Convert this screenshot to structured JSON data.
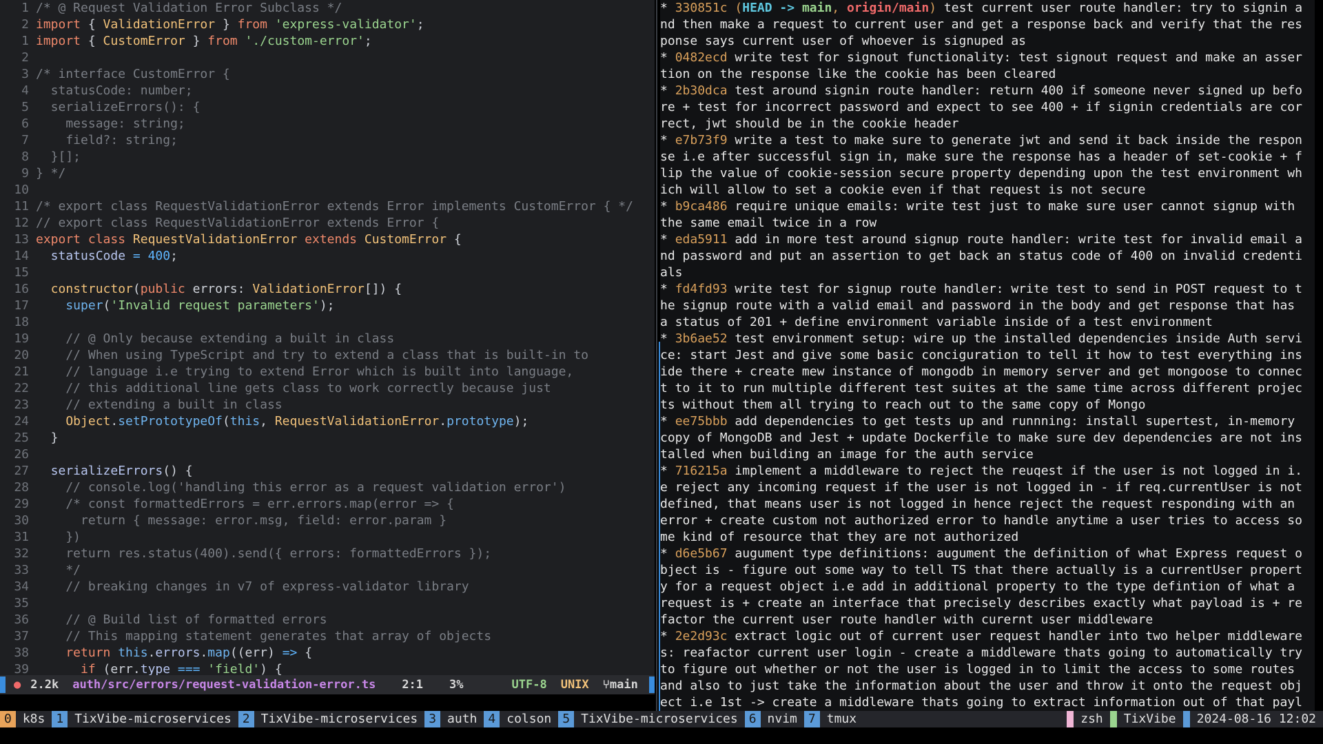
{
  "editor": {
    "lines": [
      {
        "n": "1",
        "t": [
          [
            "cm",
            "/* @ Request Validation Error Subclass */"
          ]
        ]
      },
      {
        "n": "2",
        "t": [
          [
            "kw",
            "import"
          ],
          [
            "var",
            " { "
          ],
          [
            "cls",
            "ValidationError"
          ],
          [
            "var",
            " } "
          ],
          [
            "kw",
            "from"
          ],
          [
            "var",
            " "
          ],
          [
            "str",
            "'express-validator'"
          ],
          [
            "var",
            ";"
          ]
        ]
      },
      {
        "n": "1",
        "t": [
          [
            "kw",
            "import"
          ],
          [
            "var",
            " { "
          ],
          [
            "cls",
            "CustomError"
          ],
          [
            "var",
            " } "
          ],
          [
            "kw",
            "from"
          ],
          [
            "var",
            " "
          ],
          [
            "str",
            "'./custom-error'"
          ],
          [
            "var",
            ";"
          ]
        ]
      },
      {
        "n": "2",
        "t": []
      },
      {
        "n": "3",
        "t": [
          [
            "cm",
            "/* interface CustomError {"
          ]
        ]
      },
      {
        "n": "4",
        "t": [
          [
            "cm",
            "  statusCode: number;"
          ]
        ]
      },
      {
        "n": "5",
        "t": [
          [
            "cm",
            "  serializeErrors(): {"
          ]
        ]
      },
      {
        "n": "6",
        "t": [
          [
            "cm",
            "    message: string;"
          ]
        ]
      },
      {
        "n": "7",
        "t": [
          [
            "cm",
            "    field?: string;"
          ]
        ]
      },
      {
        "n": "8",
        "t": [
          [
            "cm",
            "  }[];"
          ]
        ]
      },
      {
        "n": "9",
        "t": [
          [
            "cm",
            "} */"
          ]
        ]
      },
      {
        "n": "10",
        "t": []
      },
      {
        "n": "11",
        "t": [
          [
            "cm",
            "/* export class RequestValidationError extends Error implements CustomError { */"
          ]
        ]
      },
      {
        "n": "12",
        "t": [
          [
            "cm",
            "// export class RequestValidationError extends Error {"
          ]
        ]
      },
      {
        "n": "13",
        "t": [
          [
            "kw",
            "export class "
          ],
          [
            "cls",
            "RequestValidationError"
          ],
          [
            "kw",
            " extends "
          ],
          [
            "cls",
            "CustomError"
          ],
          [
            "var",
            " {"
          ]
        ]
      },
      {
        "n": "14",
        "t": [
          [
            "prop",
            "  statusCode"
          ],
          [
            "op",
            " = "
          ],
          [
            "num",
            "400"
          ],
          [
            "var",
            ";"
          ]
        ]
      },
      {
        "n": "15",
        "t": []
      },
      {
        "n": "16",
        "t": [
          [
            "cls",
            "  constructor"
          ],
          [
            "var",
            "("
          ],
          [
            "kw",
            "public"
          ],
          [
            "var",
            " errors: "
          ],
          [
            "cls",
            "ValidationError"
          ],
          [
            "var",
            "[]) {"
          ]
        ]
      },
      {
        "n": "17",
        "t": [
          [
            "fn",
            "    super"
          ],
          [
            "var",
            "("
          ],
          [
            "str",
            "'Invalid request parameters'"
          ],
          [
            "var",
            ");"
          ]
        ]
      },
      {
        "n": "18",
        "t": []
      },
      {
        "n": "19",
        "t": [
          [
            "cm",
            "    // @ Only because extending a built in class"
          ]
        ]
      },
      {
        "n": "20",
        "t": [
          [
            "cm",
            "    // When using TypeScript and try to extend a class that is built-in to"
          ]
        ]
      },
      {
        "n": "21",
        "t": [
          [
            "cm",
            "    // language i.e trying to extend Error which is built into language,"
          ]
        ]
      },
      {
        "n": "22",
        "t": [
          [
            "cm",
            "    // this additional line gets class to work correctly because just"
          ]
        ]
      },
      {
        "n": "23",
        "t": [
          [
            "cm",
            "    // extending a built in class"
          ]
        ]
      },
      {
        "n": "24",
        "t": [
          [
            "cls",
            "    Object"
          ],
          [
            "var",
            "."
          ],
          [
            "fn",
            "setPrototypeOf"
          ],
          [
            "var",
            "("
          ],
          [
            "fn",
            "this"
          ],
          [
            "var",
            ", "
          ],
          [
            "cls",
            "RequestValidationError"
          ],
          [
            "var",
            "."
          ],
          [
            "fn",
            "prototype"
          ],
          [
            "var",
            ");"
          ]
        ]
      },
      {
        "n": "25",
        "t": [
          [
            "var",
            "  }"
          ]
        ]
      },
      {
        "n": "26",
        "t": []
      },
      {
        "n": "27",
        "t": [
          [
            "prop",
            "  serializeErrors"
          ],
          [
            "var",
            "() {"
          ]
        ]
      },
      {
        "n": "28",
        "t": [
          [
            "cm",
            "    // console.log('handling this error as a request validation error')"
          ]
        ]
      },
      {
        "n": "29",
        "t": [
          [
            "cm",
            "    /* const formattedErrors = err.errors.map(error => {"
          ]
        ]
      },
      {
        "n": "30",
        "t": [
          [
            "cm",
            "      return { message: error.msg, field: error.param }"
          ]
        ]
      },
      {
        "n": "31",
        "t": [
          [
            "cm",
            "    })"
          ]
        ]
      },
      {
        "n": "32",
        "t": [
          [
            "cm",
            "    return res.status(400).send({ errors: formattedErrors });"
          ]
        ]
      },
      {
        "n": "33",
        "t": [
          [
            "cm",
            "    */"
          ]
        ]
      },
      {
        "n": "34",
        "t": [
          [
            "cm",
            "    // breaking changes in v7 of express-validator library"
          ]
        ]
      },
      {
        "n": "35",
        "t": []
      },
      {
        "n": "36",
        "t": [
          [
            "cm",
            "    // @ Build list of formatted errors"
          ]
        ]
      },
      {
        "n": "37",
        "t": [
          [
            "cm",
            "    // This mapping statement generates that array of objects"
          ]
        ]
      },
      {
        "n": "38",
        "t": [
          [
            "kw",
            "    return "
          ],
          [
            "fn",
            "this"
          ],
          [
            "var",
            "."
          ],
          [
            "prop",
            "errors"
          ],
          [
            "var",
            "."
          ],
          [
            "fn",
            "map"
          ],
          [
            "var",
            "(("
          ],
          [
            "var",
            "err"
          ],
          [
            "var",
            ") "
          ],
          [
            "op",
            "=>"
          ],
          [
            "var",
            " {"
          ]
        ]
      },
      {
        "n": "39",
        "t": [
          [
            "kw",
            "      if"
          ],
          [
            "var",
            " (err."
          ],
          [
            "prop",
            "type"
          ],
          [
            "op",
            " === "
          ],
          [
            "str",
            "'field'"
          ],
          [
            "var",
            ") {"
          ]
        ]
      }
    ]
  },
  "statusline": {
    "icon": "bug-icon",
    "size": "2.2k",
    "path": "auth/src/errors/request-validation-error.ts",
    "position": "2:1",
    "percent": "3%",
    "encoding": "UTF-8",
    "format": "UNIX",
    "branch_icon": "⑂",
    "branch": "main"
  },
  "log": {
    "entries": [
      {
        "hash": "330851c",
        "refs": true,
        "msg": "test current user route handler: try to signin and then make a request to current user and get a response back and verify that the response says current user of whoever is signuped as"
      },
      {
        "hash": "0482ecd",
        "msg": "write test for signout functionality: test signout request and make an assertion on the response like the cookie has been cleared"
      },
      {
        "hash": "2b30dca",
        "msg": "test around signin route handler: return 400 if someone never signed up before + test for incorrect password and expect to see 400 + if signin credentials are correct, jwt should be in the cookie header"
      },
      {
        "hash": "e7b73f9",
        "msg": "write a test to make sure to generate jwt and send it back inside the response i.e after successful sign in, make sure the response has a header of set-cookie + flip the value of cookie-session secure property depending upon the test environment which will allow to set a cookie even if that request is not secure"
      },
      {
        "hash": "b9ca486",
        "msg": "require unique emails: write test just to make sure user cannot signup with the same email twice in a row"
      },
      {
        "hash": "eda5911",
        "msg": "add in more test around signup route handler: write test for invalid email and password and put an assertion to get back an status code of 400 on invalid credentials"
      },
      {
        "hash": "fd4fd93",
        "msg": "write test for signup route handler: write test to send in POST request to the signup route with a valid email and password in the body and get response that has a status of 201 + define environment variable inside of a test environment"
      },
      {
        "hash": "3b6ae52",
        "msg": "test environment setup: wire up the installed dependencies inside Auth service: start Jest and give some basic conciguration to tell it how to test everything inside there + create mew instance of mongodb in memory server and get mongoose to connect to it to run multiple different test suites at the same time across different projects without them all trying to reach out to the same copy of Mongo"
      },
      {
        "hash": "ee75bbb",
        "msg": "add dependencies to get tests up and runnning: install supertest, in-memory copy of MongoDB and Jest + update Dockerfile to make sure dev dependencies are not installed when building an image for the auth service"
      },
      {
        "hash": "716215a",
        "msg": "implement a middleware to reject the reuqest if the user is not logged in i.e reject any incoming request if the user is not logged in - if req.currentUser is not defined, that means user is not logged in hence reject the request responding with an error + create custom not authorized error to handle anytime a user tries to access some kind of resource that they are not authorized"
      },
      {
        "hash": "d6e5b67",
        "msg": "augument type definitions: augument the definition of what Express request object is - figure out some way to tell TS that there actually is a currentUser property for a request object i.e add in additional property to the type defintion of what a request is + create an interface that precisely describes exactly what payload is + refactor the current user route handler with curernt user middleware"
      },
      {
        "hash": "2e2d93c",
        "msg": "extract logic out of current user request handler into two helper middlewares: reafactor current user login - create a middleware thats going to automatically try to figure out whether or not the user is logged in to limit the access to some routes and also to just take the information about the user and throw it onto the request object i.e 1st -> create a middleware thats going to extract information out of that payload and set it on req.currentUser so th"
      }
    ],
    "refs": {
      "head": "HEAD -> ",
      "local": "main",
      "sep": ", ",
      "remote": "origin/main"
    },
    "prompt": ":"
  },
  "tmux": {
    "windows": [
      {
        "num": "0",
        "name": "k8s"
      },
      {
        "num": "1",
        "name": "TixVibe-microservices"
      },
      {
        "num": "2",
        "name": "TixVibe-microservices"
      },
      {
        "num": "3",
        "name": "auth"
      },
      {
        "num": "4",
        "name": "colson"
      },
      {
        "num": "5",
        "name": "TixVibe-microservices"
      },
      {
        "num": "6",
        "name": "nvim"
      },
      {
        "num": "7",
        "name": "tmux"
      }
    ],
    "shell": "zsh",
    "session": "TixVibe",
    "datetime": "2024-08-16 12:02"
  }
}
